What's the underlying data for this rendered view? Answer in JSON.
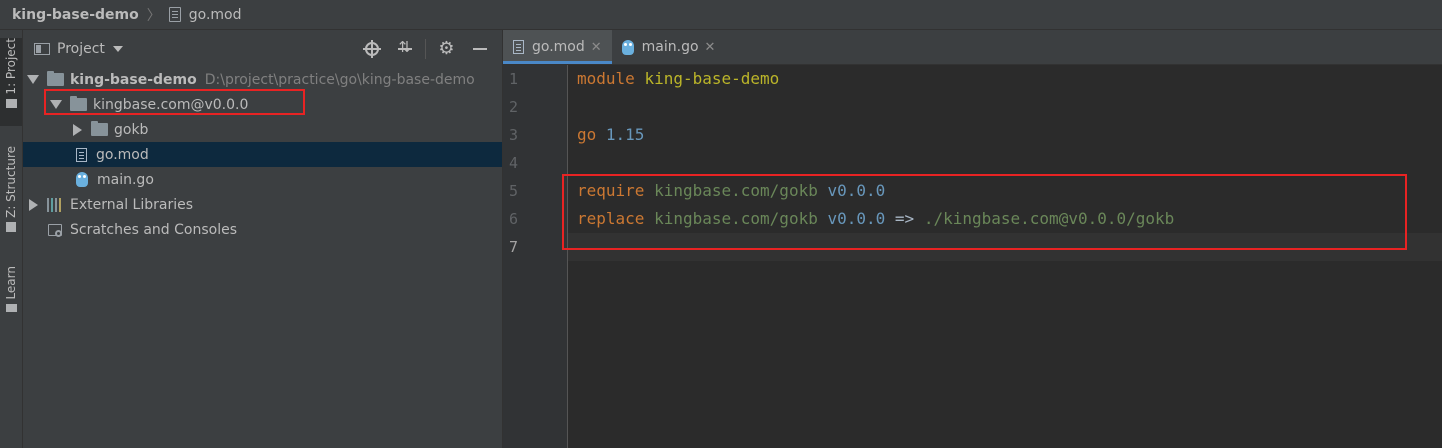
{
  "breadcrumb": {
    "project": "king-base-demo",
    "file": "go.mod"
  },
  "toolstrip": {
    "project_tab": "1: Project",
    "structure_tab": "Z: Structure",
    "learn_tab": "Learn"
  },
  "project_panel": {
    "title": "Project",
    "tree": {
      "root_name": "king-base-demo",
      "root_path": "D:\\project\\practice\\go\\king-base-demo",
      "module_folder": "kingbase.com@v0.0.0",
      "sub_folder": "gokb",
      "file_gomod": "go.mod",
      "file_maingo": "main.go",
      "external_libraries": "External Libraries",
      "scratches": "Scratches and Consoles"
    }
  },
  "editor": {
    "tabs": [
      {
        "label": "go.mod",
        "active": true
      },
      {
        "label": "main.go",
        "active": false
      }
    ],
    "line_numbers": [
      "1",
      "2",
      "3",
      "4",
      "5",
      "6",
      "7"
    ],
    "code": {
      "l1_kw": "module",
      "l1_name": "king-base-demo",
      "l3_kw": "go",
      "l3_ver": "1.15",
      "l5_kw": "require",
      "l5_path": "kingbase.com/gokb",
      "l5_ver": "v0.0.0",
      "l6_kw": "replace",
      "l6_path": "kingbase.com/gokb",
      "l6_ver": "v0.0.0",
      "l6_op": "=>",
      "l6_target": "./kingbase.com@v0.0.0/gokb"
    }
  },
  "colors": {
    "keyword": "#cc7832",
    "module_name": "#bbb529",
    "path": "#6a8759",
    "version": "#6897bb",
    "highlight_box": "#e82323",
    "selection": "#0d293e"
  }
}
